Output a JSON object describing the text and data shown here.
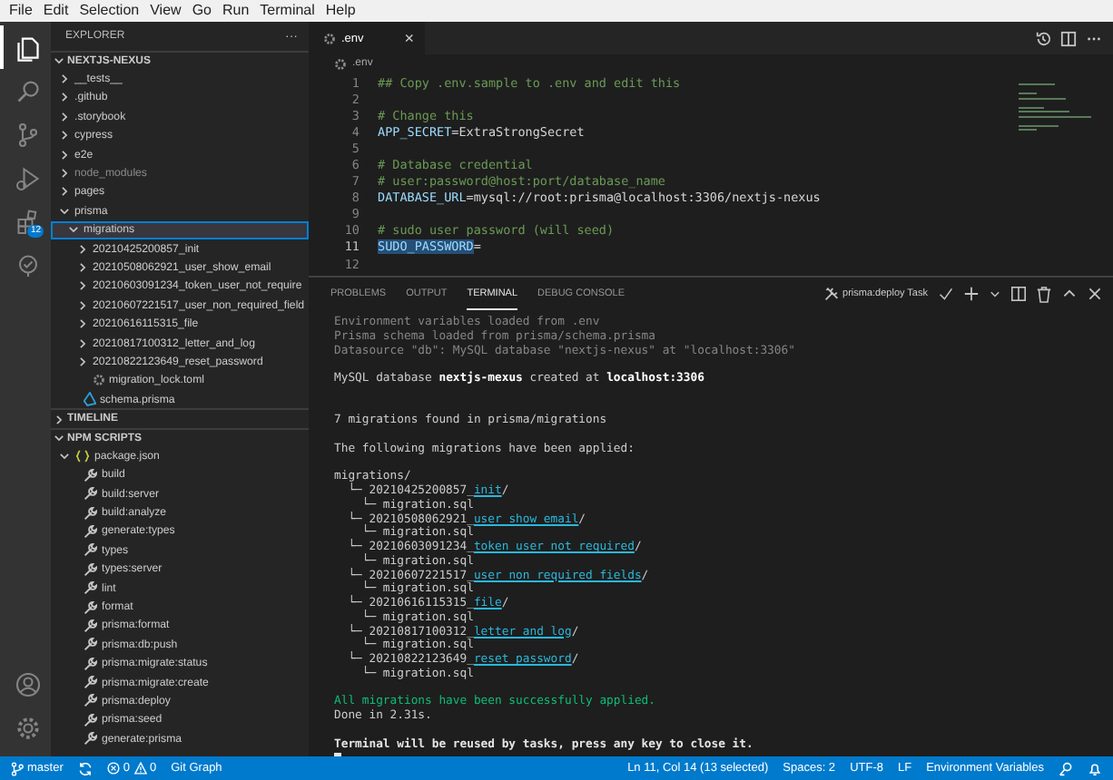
{
  "menu_bar": [
    "File",
    "Edit",
    "Selection",
    "View",
    "Go",
    "Run",
    "Terminal",
    "Help"
  ],
  "activity_bar": {
    "top": [
      {
        "kind": "explorer",
        "selected": true
      },
      {
        "kind": "search",
        "selected": false
      },
      {
        "kind": "source-control",
        "selected": false
      },
      {
        "kind": "run-debug",
        "selected": false
      },
      {
        "kind": "extensions",
        "selected": false,
        "badge": "12"
      },
      {
        "kind": "remote",
        "selected": false
      }
    ],
    "bottom": [
      {
        "kind": "account"
      },
      {
        "kind": "settings"
      }
    ]
  },
  "sidebar": {
    "title": "EXPLORER",
    "more": "···",
    "sections": [
      {
        "title": "NEXTJS-NEXUS",
        "expanded": true,
        "items": [
          {
            "label": "__tests__",
            "kind": "folder",
            "expanded": false,
            "selected": false,
            "dimmed": false
          },
          {
            "label": ".github",
            "kind": "folder",
            "expanded": false,
            "selected": false,
            "dimmed": false
          },
          {
            "label": ".storybook",
            "kind": "folder",
            "expanded": false,
            "selected": false,
            "dimmed": false
          },
          {
            "label": "cypress",
            "kind": "folder",
            "expanded": false,
            "selected": false,
            "dimmed": false
          },
          {
            "label": "e2e",
            "kind": "folder",
            "expanded": false,
            "selected": false,
            "dimmed": false
          },
          {
            "label": "node_modules",
            "kind": "folder",
            "expanded": false,
            "selected": false,
            "dimmed": true
          },
          {
            "label": "pages",
            "kind": "folder",
            "expanded": false,
            "selected": false,
            "dimmed": false
          },
          {
            "label": "prisma",
            "kind": "folder",
            "expanded": true,
            "selected": false,
            "dimmed": false,
            "children": [
              {
                "label": "migrations",
                "kind": "folder",
                "expanded": true,
                "selected": true,
                "dimmed": false,
                "children": [
                  {
                    "label": "20210425200857_init",
                    "kind": "folder",
                    "expanded": false,
                    "selected": false,
                    "dimmed": false
                  },
                  {
                    "label": "20210508062921_user_show_email",
                    "kind": "folder",
                    "expanded": false,
                    "selected": false,
                    "dimmed": false
                  },
                  {
                    "label": "20210603091234_token_user_not_require",
                    "kind": "folder",
                    "expanded": false,
                    "selected": false,
                    "dimmed": false
                  },
                  {
                    "label": "20210607221517_user_non_required_field",
                    "kind": "folder",
                    "expanded": false,
                    "selected": false,
                    "dimmed": false
                  },
                  {
                    "label": "20210616115315_file",
                    "kind": "folder",
                    "expanded": false,
                    "selected": false,
                    "dimmed": false
                  },
                  {
                    "label": "20210817100312_letter_and_log",
                    "kind": "folder",
                    "expanded": false,
                    "selected": false,
                    "dimmed": false
                  },
                  {
                    "label": "20210822123649_reset_password",
                    "kind": "folder",
                    "expanded": false,
                    "selected": false,
                    "dimmed": false
                  },
                  {
                    "label": "migration_lock.toml",
                    "kind": "config-file",
                    "selected": false,
                    "dimmed": false
                  }
                ]
              },
              {
                "label": "schema.prisma",
                "kind": "prisma-file",
                "selected": false,
                "dimmed": false
              }
            ]
          }
        ]
      },
      {
        "title": "TIMELINE",
        "expanded": false
      },
      {
        "title": "NPM SCRIPTS",
        "expanded": true,
        "items": [
          {
            "label": "package.json",
            "kind": "json-file",
            "expanded": true,
            "selected": false,
            "dimmed": false,
            "children": [
              {
                "label": "build",
                "kind": "script",
                "selected": false,
                "dimmed": false
              },
              {
                "label": "build:server",
                "kind": "script",
                "selected": false,
                "dimmed": false
              },
              {
                "label": "build:analyze",
                "kind": "script",
                "selected": false,
                "dimmed": false
              },
              {
                "label": "generate:types",
                "kind": "script",
                "selected": false,
                "dimmed": false
              },
              {
                "label": "types",
                "kind": "script",
                "selected": false,
                "dimmed": false
              },
              {
                "label": "types:server",
                "kind": "script",
                "selected": false,
                "dimmed": false
              },
              {
                "label": "lint",
                "kind": "script",
                "selected": false,
                "dimmed": false
              },
              {
                "label": "format",
                "kind": "script",
                "selected": false,
                "dimmed": false
              },
              {
                "label": "prisma:format",
                "kind": "script",
                "selected": false,
                "dimmed": false
              },
              {
                "label": "prisma:db:push",
                "kind": "script",
                "selected": false,
                "dimmed": false
              },
              {
                "label": "prisma:migrate:status",
                "kind": "script",
                "selected": false,
                "dimmed": false
              },
              {
                "label": "prisma:migrate:create",
                "kind": "script",
                "selected": false,
                "dimmed": false
              },
              {
                "label": "prisma:deploy",
                "kind": "script",
                "selected": false,
                "dimmed": false
              },
              {
                "label": "prisma:seed",
                "kind": "script",
                "selected": false,
                "dimmed": false
              },
              {
                "label": "generate:prisma",
                "kind": "script",
                "selected": false,
                "dimmed": false
              }
            ]
          }
        ]
      }
    ]
  },
  "editor": {
    "tabs": [
      {
        "label": ".env",
        "selected": true,
        "close": "×"
      }
    ],
    "breadcrumb": ".env",
    "lines": [
      {
        "number": "1",
        "kind": "comment",
        "text": "## Copy .env.sample to .env and edit this",
        "current": false
      },
      {
        "number": "2",
        "kind": "blank",
        "current": false
      },
      {
        "number": "3",
        "kind": "comment",
        "text": "# Change this",
        "current": false
      },
      {
        "number": "4",
        "kind": "assignment",
        "key": "APP_SECRET",
        "value": "=ExtraStrongSecret",
        "current": false
      },
      {
        "number": "5",
        "kind": "blank",
        "current": false
      },
      {
        "number": "6",
        "kind": "comment",
        "text": "# Database credential",
        "current": false
      },
      {
        "number": "7",
        "kind": "comment",
        "text": "# user:password@host:port/database_name",
        "current": false
      },
      {
        "number": "8",
        "kind": "assignment",
        "key": "DATABASE_URL",
        "value": "=mysql://root:prisma@localhost:3306/nextjs-nexus",
        "current": false
      },
      {
        "number": "9",
        "kind": "blank",
        "current": false
      },
      {
        "number": "10",
        "kind": "comment",
        "text": "# sudo user password (will seed)",
        "current": false
      },
      {
        "number": "11",
        "kind": "assignment",
        "key": "SUDO_PASSWORD",
        "value": "=",
        "current": true
      },
      {
        "number": "12",
        "kind": "blank",
        "current": false
      }
    ]
  },
  "panel": {
    "tabs": [
      {
        "label": "PROBLEMS",
        "selected": false
      },
      {
        "label": "OUTPUT",
        "selected": false
      },
      {
        "label": "TERMINAL",
        "selected": true
      },
      {
        "label": "DEBUG CONSOLE",
        "selected": false
      }
    ],
    "task": "prisma:deploy Task",
    "terminal": [
      {
        "kind": "dim",
        "text": "Environment variables loaded from .env"
      },
      {
        "kind": "dim",
        "text": "Prisma schema loaded from prisma/schema.prisma"
      },
      {
        "kind": "dim",
        "text": "Datasource \"db\": MySQL database \"nextjs-nexus\" at \"localhost:3306\""
      },
      {
        "kind": "blank"
      },
      {
        "kind": "normal",
        "text": "MySQL database **nextjs-mexus** created at **localhost:3306**"
      },
      {
        "kind": "blank"
      },
      {
        "kind": "blank"
      },
      {
        "kind": "normal",
        "text": "7 migrations found in prisma/migrations"
      },
      {
        "kind": "blank"
      },
      {
        "kind": "normal",
        "text": "The following migrations have been applied:"
      },
      {
        "kind": "blank"
      },
      {
        "kind": "normal",
        "text": "migrations/"
      },
      {
        "kind": "migration",
        "prefix": "  └─ 20210425200857_",
        "name": "init",
        "suffix": "/"
      },
      {
        "kind": "normal",
        "text": "    └─ migration.sql"
      },
      {
        "kind": "migration",
        "prefix": "  └─ 20210508062921_",
        "name": "user_show_email",
        "suffix": "/"
      },
      {
        "kind": "normal",
        "text": "    └─ migration.sql"
      },
      {
        "kind": "migration",
        "prefix": "  └─ 20210603091234_",
        "name": "token_user_not_required",
        "suffix": "/"
      },
      {
        "kind": "normal",
        "text": "    └─ migration.sql"
      },
      {
        "kind": "migration",
        "prefix": "  └─ 20210607221517_",
        "name": "user_non_required_fields",
        "suffix": "/"
      },
      {
        "kind": "normal",
        "text": "    └─ migration.sql"
      },
      {
        "kind": "migration",
        "prefix": "  └─ 20210616115315_",
        "name": "file",
        "suffix": "/"
      },
      {
        "kind": "normal",
        "text": "    └─ migration.sql"
      },
      {
        "kind": "migration",
        "prefix": "  └─ 20210817100312_",
        "name": "letter_and_log",
        "suffix": "/"
      },
      {
        "kind": "normal",
        "text": "    └─ migration.sql"
      },
      {
        "kind": "migration",
        "prefix": "  └─ 20210822123649_",
        "name": "reset_password",
        "suffix": "/"
      },
      {
        "kind": "normal",
        "text": "    └─ migration.sql"
      },
      {
        "kind": "blank"
      },
      {
        "kind": "success",
        "text": "All migrations have been successfully applied."
      },
      {
        "kind": "normal",
        "text": "Done in 2.31s."
      },
      {
        "kind": "blank"
      },
      {
        "kind": "bold",
        "text": "Terminal will be reused by tasks, press any key to close it."
      },
      {
        "kind": "cursor"
      }
    ]
  },
  "status_bar": {
    "left": [
      {
        "kind": "branch",
        "text": "master"
      },
      {
        "kind": "sync"
      },
      {
        "kind": "problems",
        "errors": "0",
        "warnings": "0"
      },
      {
        "kind": "text",
        "text": "Git Graph"
      }
    ],
    "right": [
      {
        "kind": "text",
        "text": "Ln 11, Col 14 (13 selected)"
      },
      {
        "kind": "text",
        "text": "Spaces: 2"
      },
      {
        "kind": "text",
        "text": "UTF-8"
      },
      {
        "kind": "text",
        "text": "LF"
      },
      {
        "kind": "text",
        "text": "Environment Variables"
      },
      {
        "kind": "feedback"
      },
      {
        "kind": "bell"
      }
    ]
  }
}
